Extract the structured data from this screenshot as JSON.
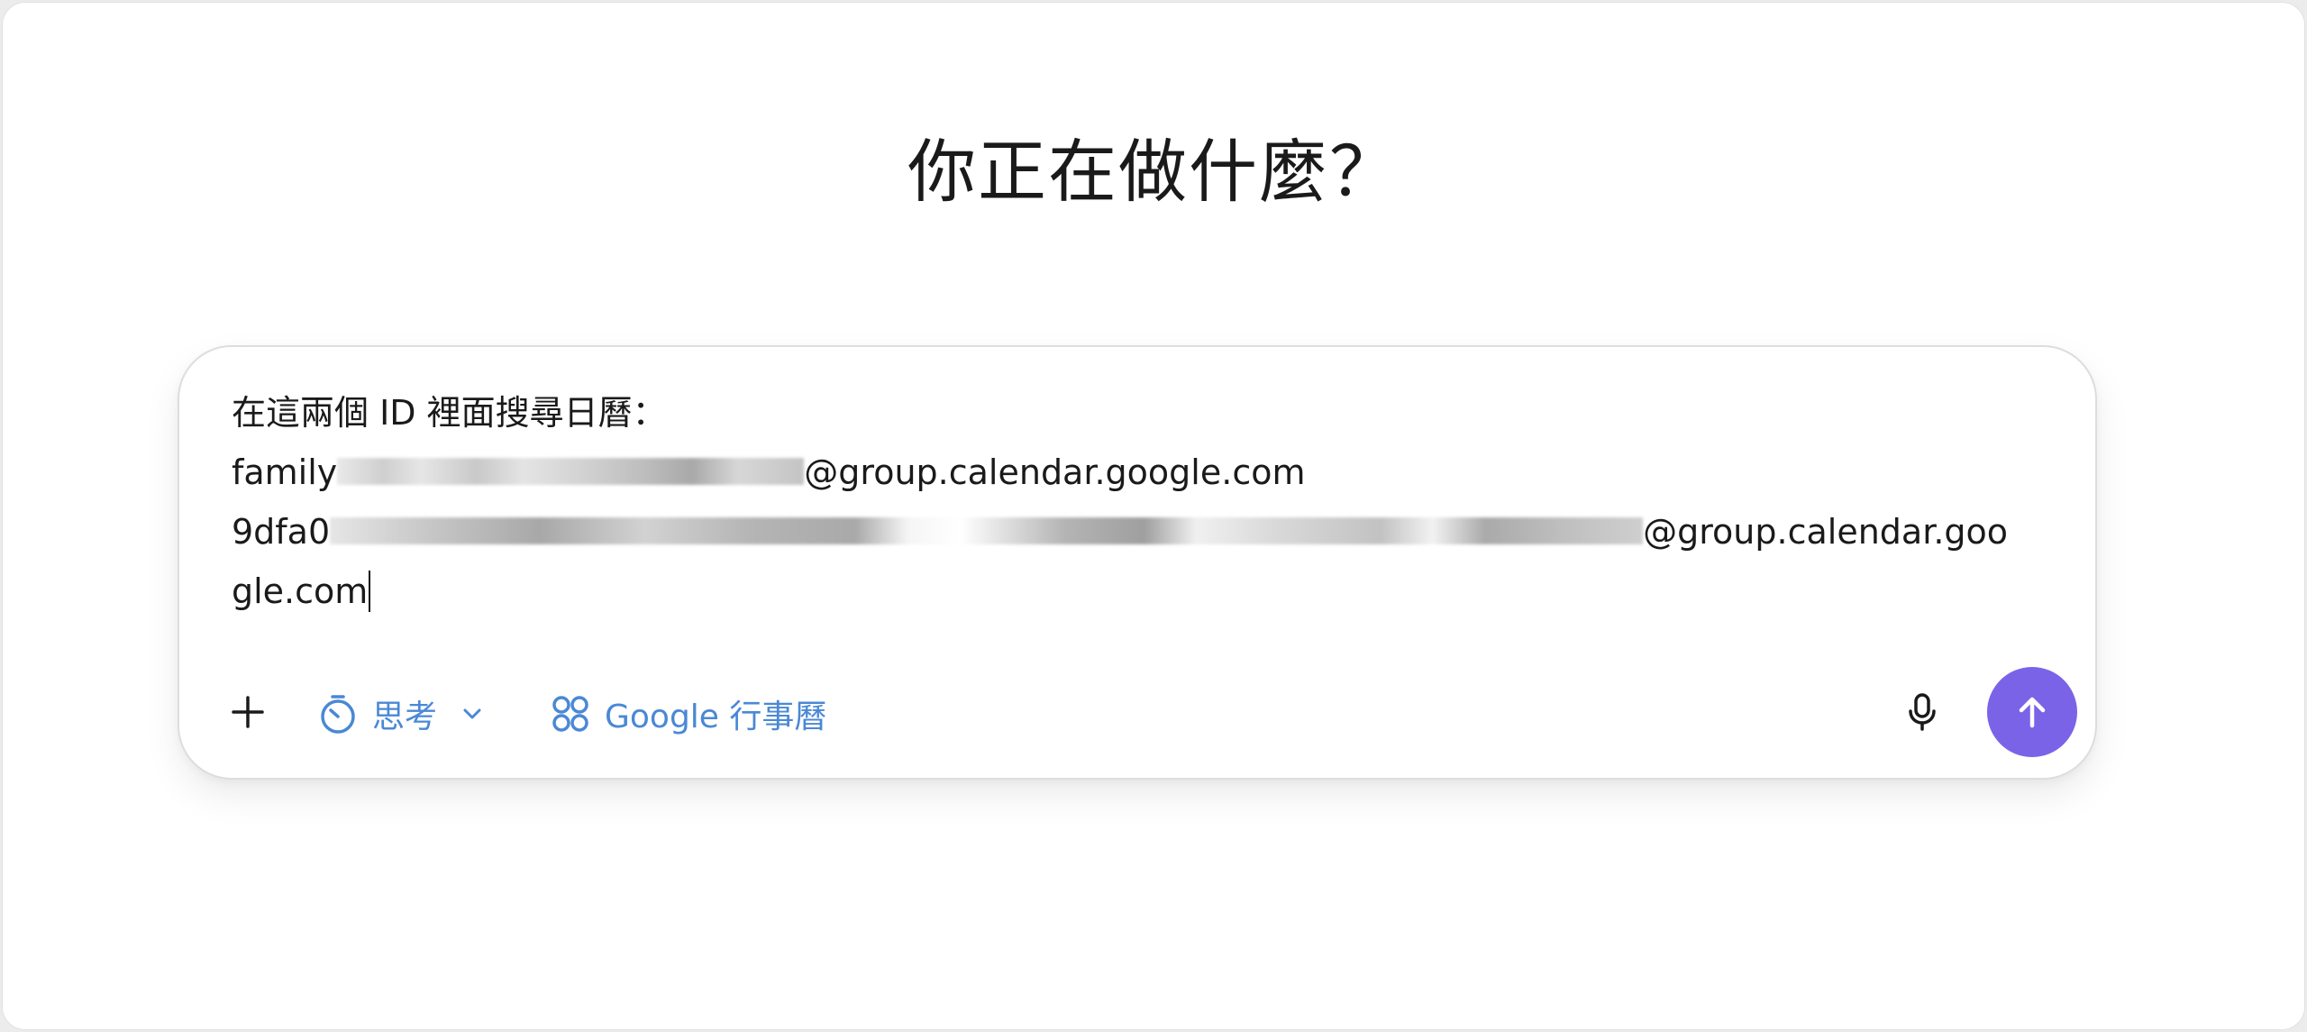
{
  "header": {
    "title": "你正在做什麼？"
  },
  "composer": {
    "lines": {
      "line1": "在這兩個 ID 裡面搜尋日曆：",
      "line2_prefix": "family",
      "line2_suffix": "@group.calendar.google.com",
      "line3_prefix": "9dfa0",
      "line3_suffix": "@group.calendar.goo",
      "line4": "gle.com"
    },
    "toolbar": {
      "add_icon": "plus-icon",
      "think_label": "思考",
      "think_icon": "timer-icon",
      "think_caret_icon": "chevron-down-icon",
      "integration_label": "Google 行事曆",
      "integration_icon": "apps-grid-icon",
      "mic_icon": "microphone-icon",
      "send_icon": "arrow-up-icon"
    }
  },
  "colors": {
    "accent_blue": "#4a88d6",
    "send_purple": "#7b63e8",
    "text_dark": "#1a1a1a"
  }
}
